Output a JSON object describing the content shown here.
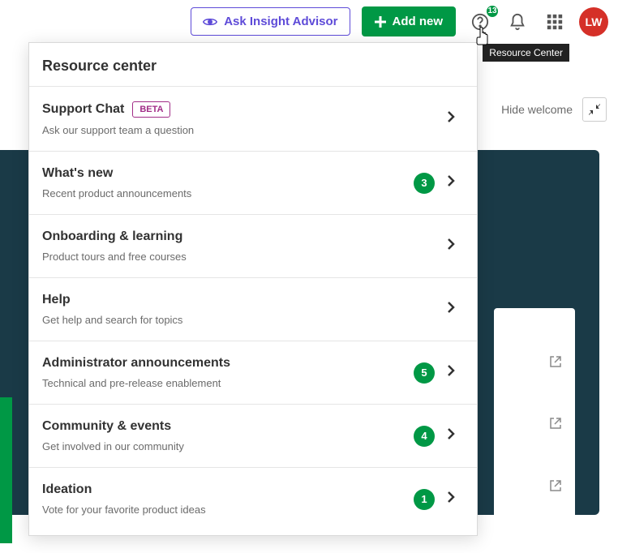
{
  "topbar": {
    "ask_label": "Ask Insight Advisor",
    "add_label": "Add new",
    "help_badge": "13",
    "avatar_initials": "LW"
  },
  "tooltip": "Resource Center",
  "hide_welcome": "Hide welcome",
  "panel": {
    "title": "Resource center",
    "items": [
      {
        "title": "Support Chat",
        "desc": "Ask our support team a question",
        "badge": "BETA",
        "count": null
      },
      {
        "title": "What's new",
        "desc": "Recent product announcements",
        "badge": null,
        "count": "3"
      },
      {
        "title": "Onboarding & learning",
        "desc": "Product tours and free courses",
        "badge": null,
        "count": null
      },
      {
        "title": "Help",
        "desc": "Get help and search for topics",
        "badge": null,
        "count": null
      },
      {
        "title": "Administrator announcements",
        "desc": "Technical and pre-release enablement",
        "badge": null,
        "count": "5"
      },
      {
        "title": "Community & events",
        "desc": "Get involved in our community",
        "badge": null,
        "count": "4"
      },
      {
        "title": "Ideation",
        "desc": "Vote for your favorite product ideas",
        "badge": null,
        "count": "1"
      }
    ]
  }
}
